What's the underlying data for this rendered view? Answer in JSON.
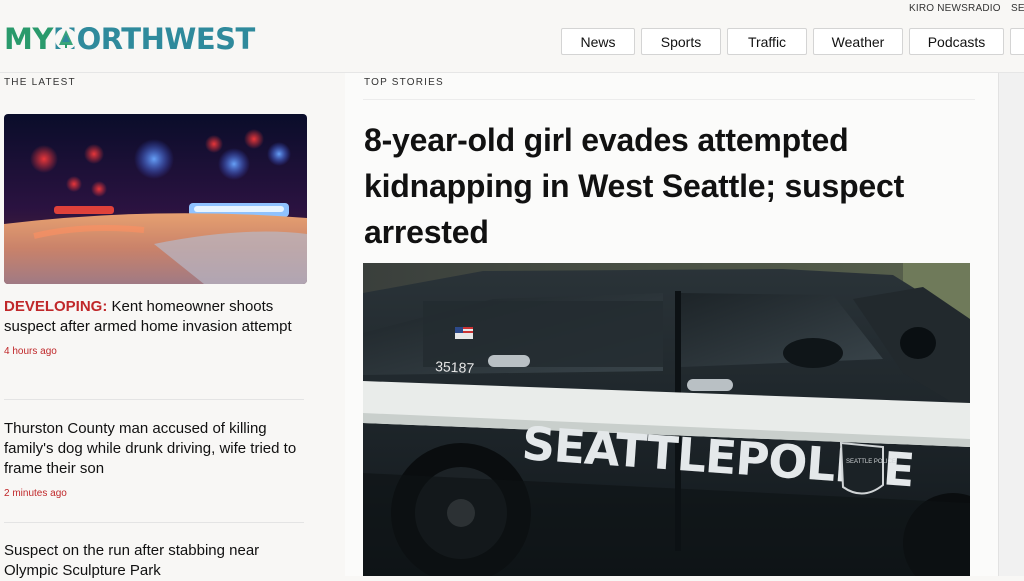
{
  "topbar": {
    "links": [
      "KIRO NEWSRADIO",
      "SE"
    ]
  },
  "brand": {
    "logo_my": "MY",
    "logo_nw": "NORTHWEST",
    "colors": {
      "green": "#2a9a6c",
      "teal": "#2f8a9c",
      "accent_red": "#c0282a"
    }
  },
  "nav": {
    "items": [
      "News",
      "Sports",
      "Traffic",
      "Weather",
      "Podcasts"
    ]
  },
  "latest": {
    "section_label": "THE LATEST",
    "stories": [
      {
        "tag": "DEVELOPING:",
        "title": " Kent homeowner shoots suspect after armed home invasion attempt",
        "time": "4 hours ago"
      },
      {
        "tag": "",
        "title": "Thurston County man accused of killing family's dog while drunk driving, wife tried to frame their son",
        "time": "2 minutes ago"
      },
      {
        "tag": "",
        "title": "Suspect on the run after stabbing near Olympic Sculpture Park",
        "time": ""
      }
    ]
  },
  "top_stories": {
    "section_label": "TOP STORIES",
    "headline": "8-year-old girl evades attempted kidnapping in West Seattle; suspect arrested",
    "hero_image": {
      "icon": "police-suv-photo",
      "door_text": "SEATTLEPOLICE",
      "unit_number": "35187",
      "badge_text": "SEATTLE POLICE"
    }
  }
}
